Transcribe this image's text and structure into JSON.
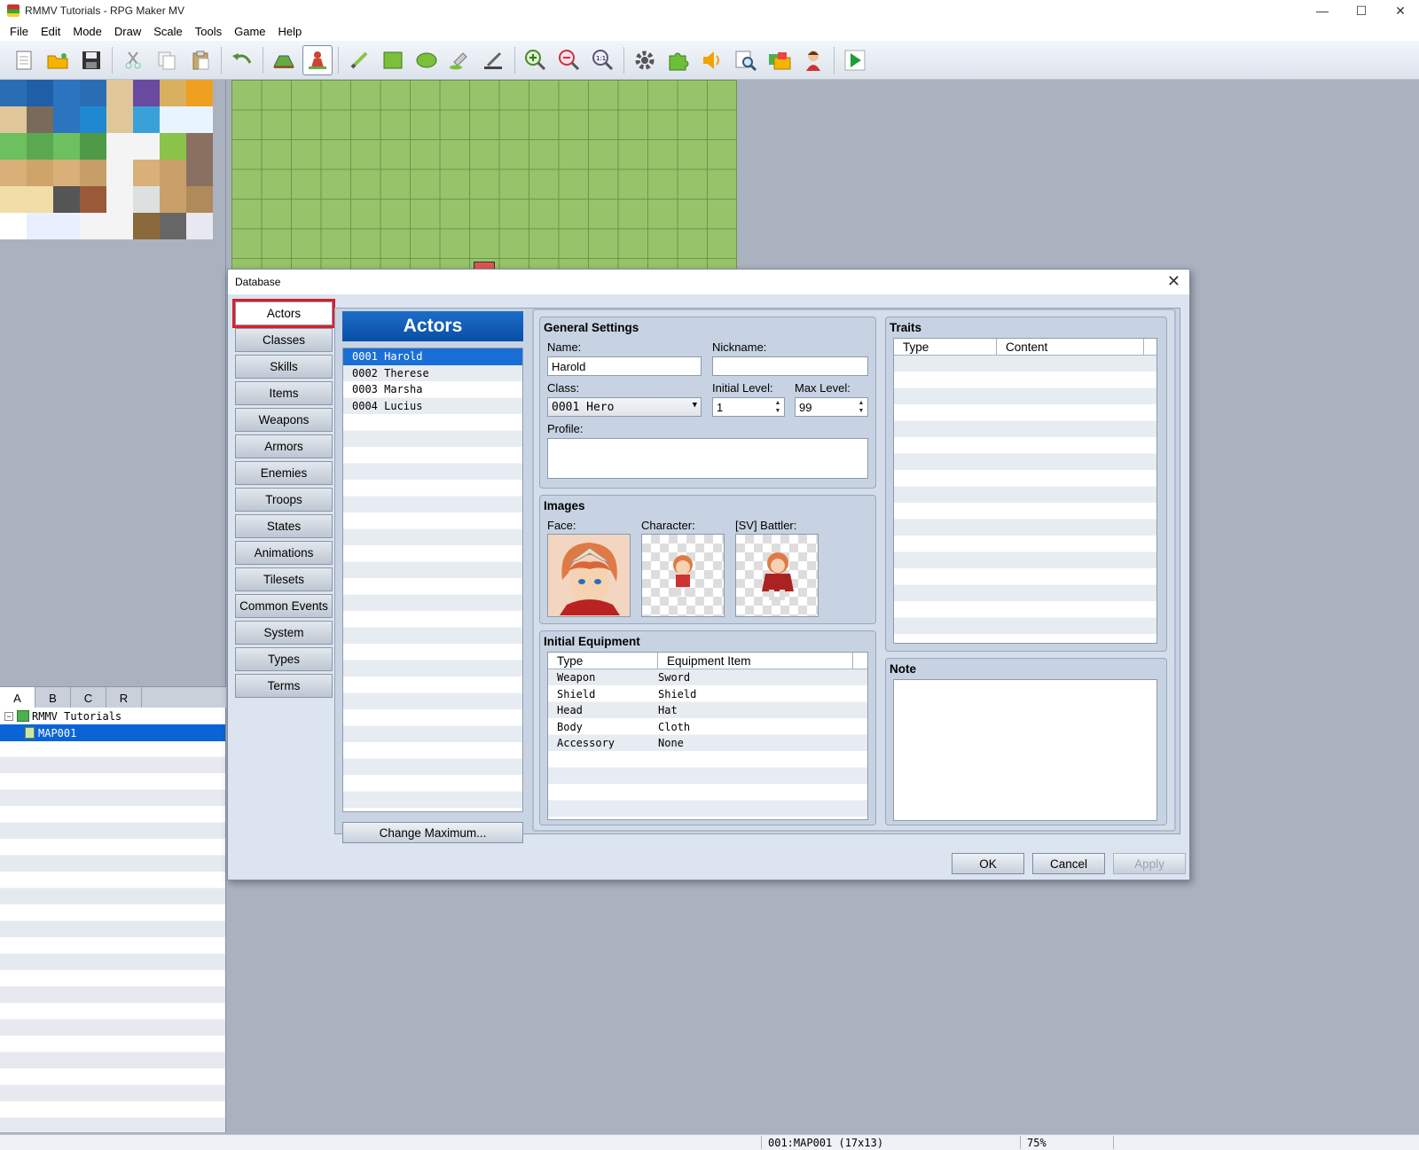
{
  "window": {
    "title": "RMMV Tutorials - RPG Maker MV",
    "minimize": "—",
    "maximize": "☐",
    "close": "✕"
  },
  "menu": [
    "File",
    "Edit",
    "Mode",
    "Draw",
    "Scale",
    "Tools",
    "Game",
    "Help"
  ],
  "toolbar": [
    "new-icon",
    "open-icon",
    "save-icon",
    "|",
    "cut-icon",
    "copy-icon",
    "paste-icon",
    "|",
    "undo-icon",
    "|",
    "map-mode-icon",
    "event-mode-icon",
    "|",
    "pencil-icon",
    "rectangle-icon",
    "ellipse-icon",
    "fill-icon",
    "shadow-pen-icon",
    "|",
    "zoom-in-icon",
    "zoom-out-icon",
    "zoom-actual-icon",
    "|",
    "database-icon",
    "plugin-manager-icon",
    "sound-test-icon",
    "event-searcher-icon",
    "resource-manager-icon",
    "character-generator-icon",
    "|",
    "playtest-icon"
  ],
  "layer_tabs": [
    "A",
    "B",
    "C",
    "R"
  ],
  "map_tree": {
    "project": "RMMV Tutorials",
    "maps": [
      "MAP001"
    ]
  },
  "status": {
    "map": "001:MAP001 (17x13)",
    "zoom": "75%"
  },
  "database": {
    "title": "Database",
    "close": "✕",
    "nav": [
      "Actors",
      "Classes",
      "Skills",
      "Items",
      "Weapons",
      "Armors",
      "Enemies",
      "Troops",
      "States",
      "Animations",
      "Tilesets",
      "Common Events",
      "System",
      "Types",
      "Terms"
    ],
    "list_header": "Actors",
    "actors": [
      "0001 Harold",
      "0002 Therese",
      "0003 Marsha",
      "0004 Lucius"
    ],
    "change_max": "Change Maximum...",
    "general": {
      "title": "General Settings",
      "name_label": "Name:",
      "name": "Harold",
      "nickname_label": "Nickname:",
      "nickname": "",
      "class_label": "Class:",
      "class": "0001 Hero",
      "initial_level_label": "Initial Level:",
      "initial_level": "1",
      "max_level_label": "Max Level:",
      "max_level": "99",
      "profile_label": "Profile:",
      "profile": ""
    },
    "images": {
      "title": "Images",
      "face_label": "Face:",
      "character_label": "Character:",
      "battler_label": "[SV] Battler:"
    },
    "equipment": {
      "title": "Initial Equipment",
      "col_type": "Type",
      "col_item": "Equipment Item",
      "rows": [
        {
          "type": "Weapon",
          "item": "Sword"
        },
        {
          "type": "Shield",
          "item": "Shield"
        },
        {
          "type": "Head",
          "item": "Hat"
        },
        {
          "type": "Body",
          "item": "Cloth"
        },
        {
          "type": "Accessory",
          "item": "None"
        }
      ]
    },
    "traits": {
      "title": "Traits",
      "col_type": "Type",
      "col_content": "Content"
    },
    "note": {
      "title": "Note"
    },
    "buttons": {
      "ok": "OK",
      "cancel": "Cancel",
      "apply": "Apply"
    }
  }
}
